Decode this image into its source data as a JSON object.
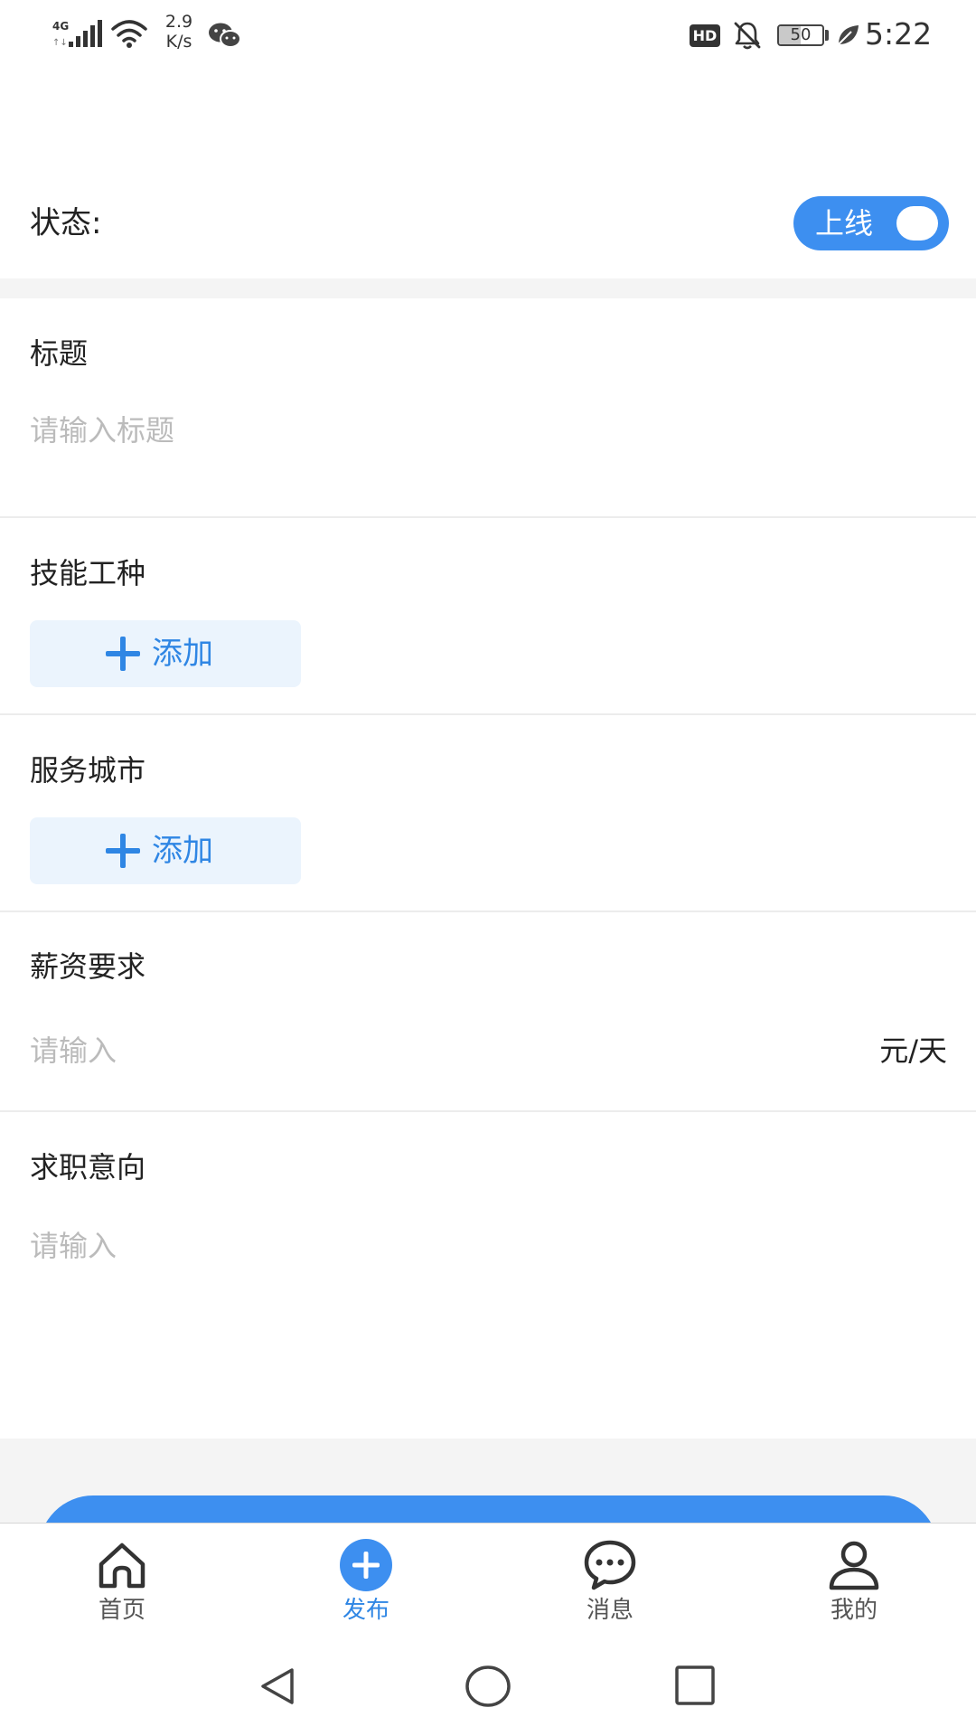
{
  "status_bar": {
    "network": "4G",
    "speed_value": "2.9",
    "speed_unit": "K/s",
    "hd_badge": "HD",
    "battery_level": 50,
    "battery_text": "50",
    "time": "5:22",
    "icons": [
      "signal-icon",
      "wifi-icon",
      "wechat-icon",
      "mute-bell-icon",
      "battery-icon",
      "leaf-icon"
    ]
  },
  "status_row": {
    "label": "状态:",
    "toggle_text": "上线",
    "toggle_on": true
  },
  "form": {
    "title": {
      "label": "标题",
      "placeholder": "请输入标题"
    },
    "skill": {
      "label": "技能工种",
      "add_label": "添加"
    },
    "city": {
      "label": "服务城市",
      "add_label": "添加"
    },
    "salary": {
      "label": "薪资要求",
      "placeholder": "请输入",
      "unit": "元/天"
    },
    "intent": {
      "label": "求职意向",
      "placeholder": "请输入"
    }
  },
  "tabbar": {
    "items": [
      {
        "label": "首页",
        "icon": "home-icon",
        "active": false
      },
      {
        "label": "发布",
        "icon": "add-circle-icon",
        "active": true
      },
      {
        "label": "消息",
        "icon": "chat-icon",
        "active": false
      },
      {
        "label": "我的",
        "icon": "person-icon",
        "active": false
      }
    ]
  },
  "nav": {
    "keys": [
      "back-icon",
      "home-circle-icon",
      "recents-icon"
    ]
  },
  "colors": {
    "accent": "#3d8ff0",
    "accent_text": "#2f86e4",
    "add_button_bg": "#ebf4fd",
    "placeholder": "#bbbbbb",
    "band": "#f4f4f4"
  }
}
